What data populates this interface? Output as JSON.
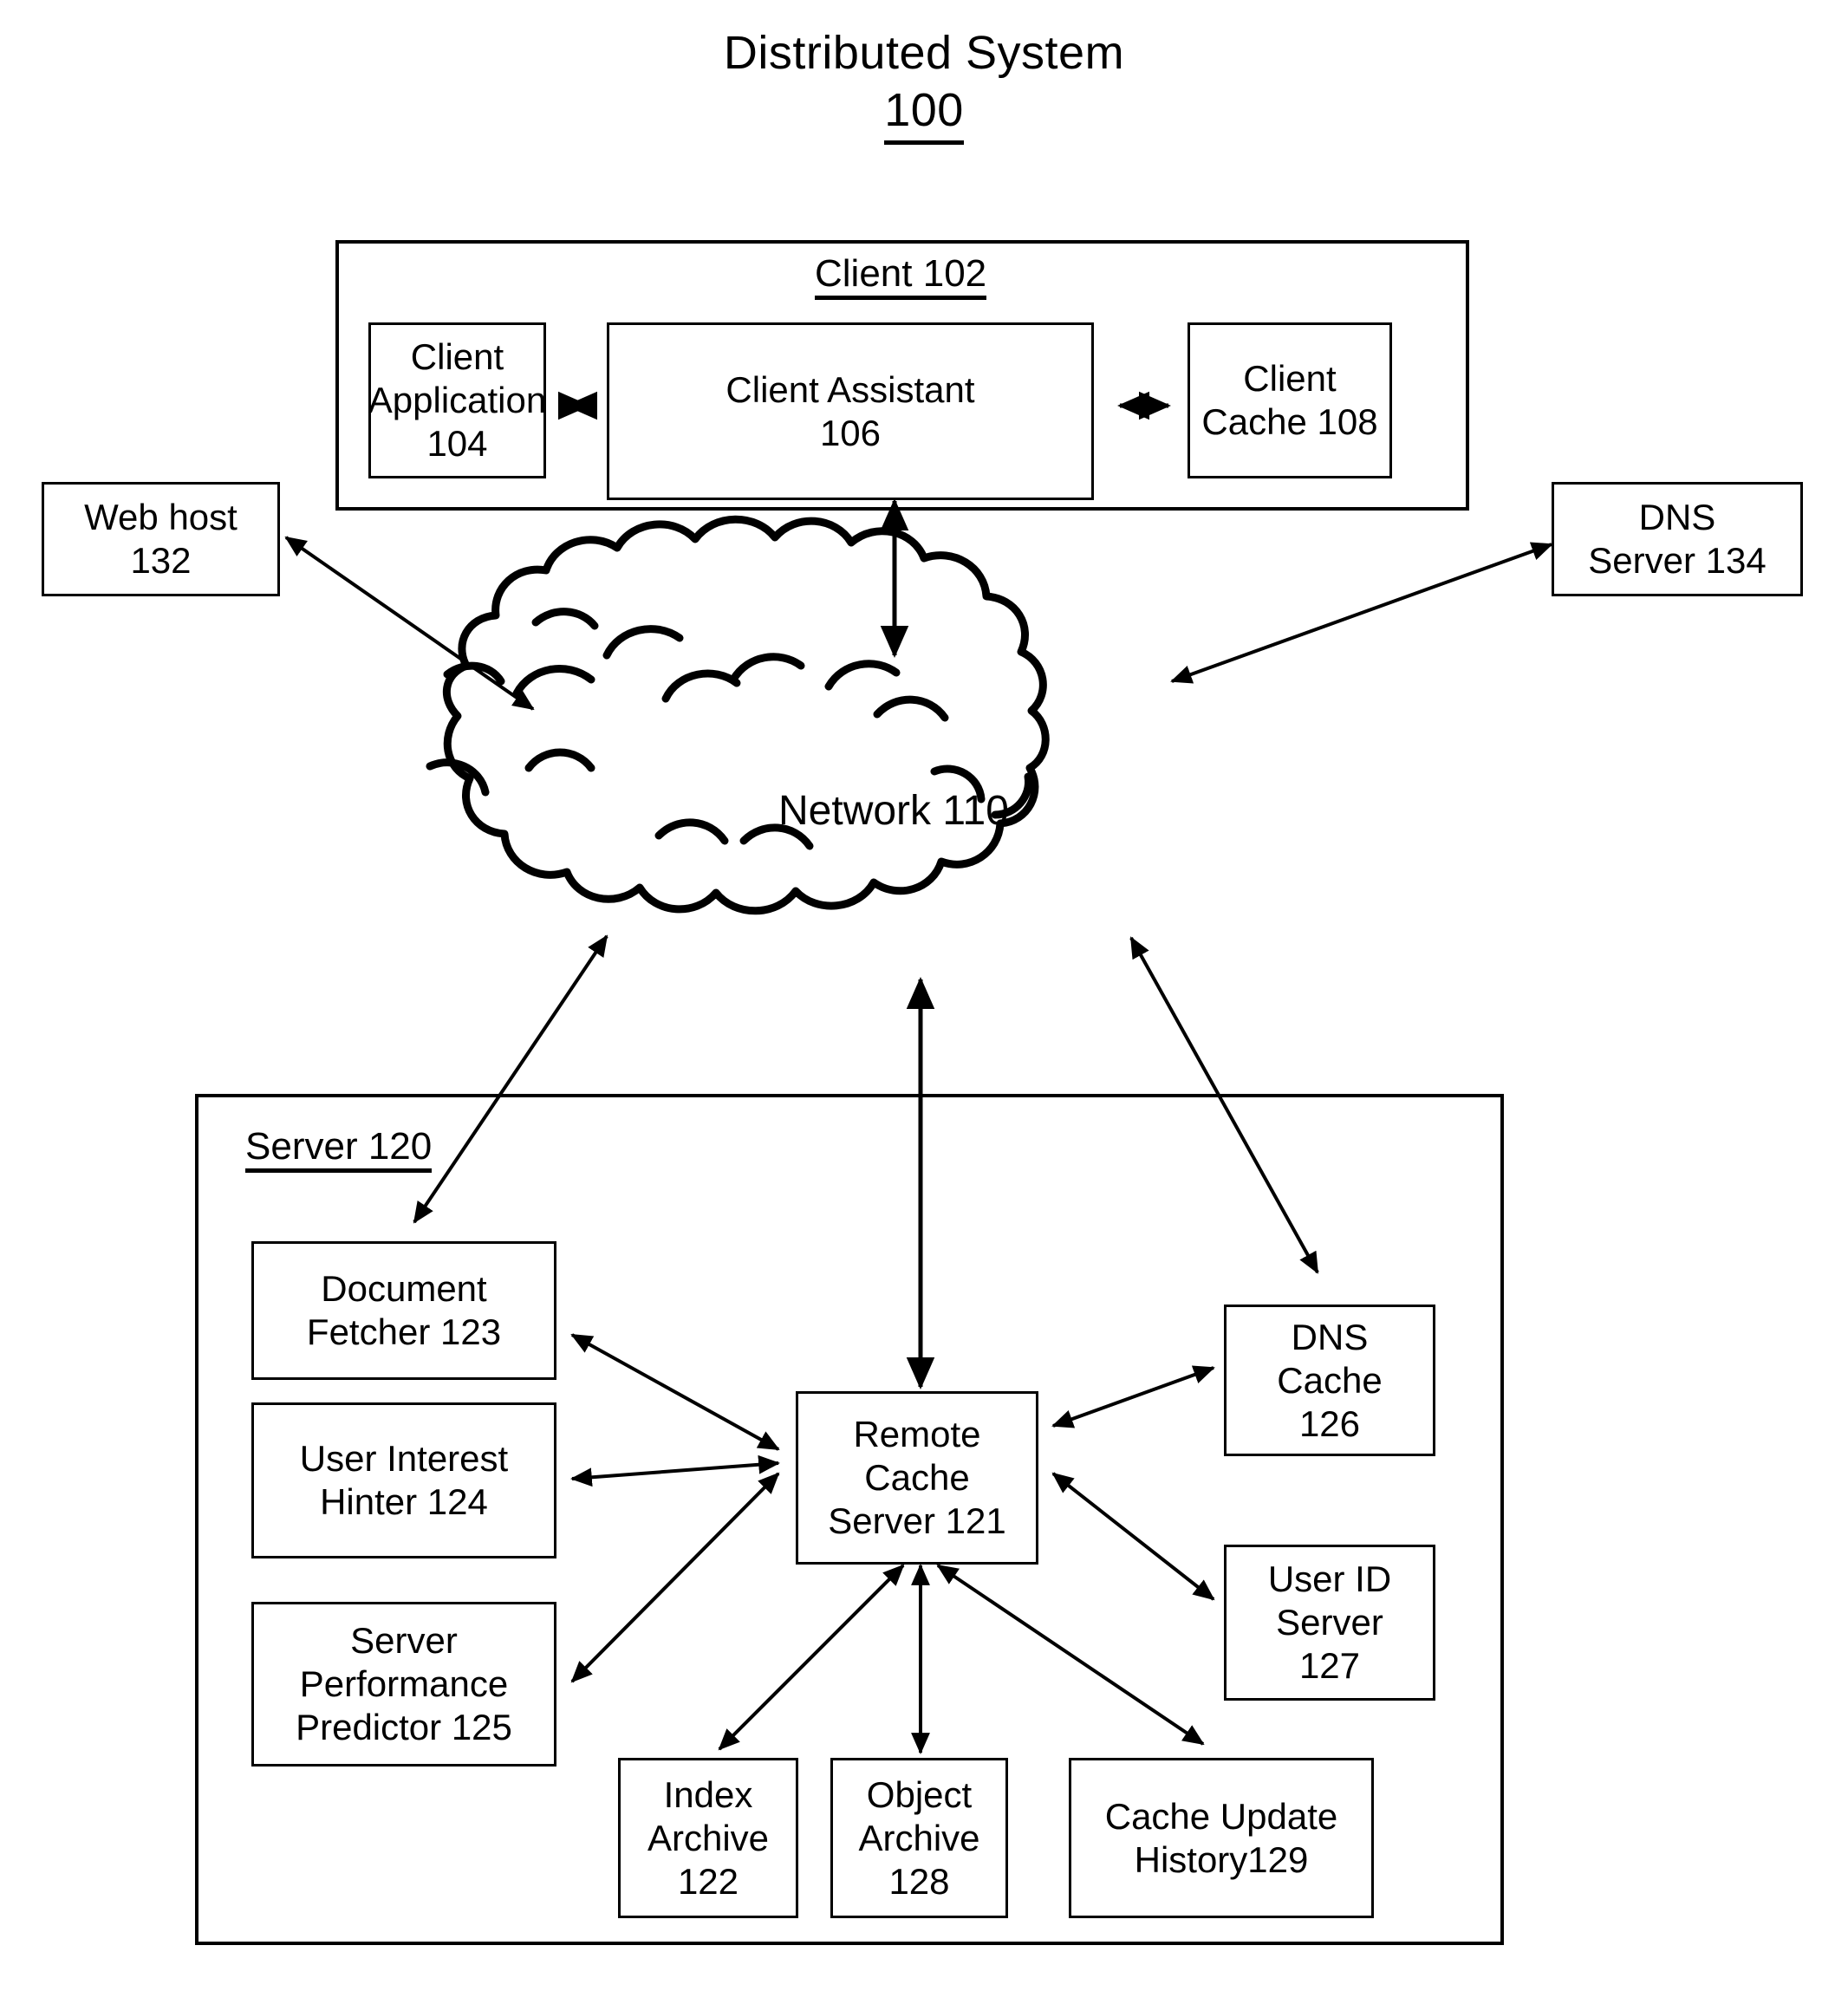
{
  "figure": {
    "title_line1": "Distributed System",
    "title_number": "100"
  },
  "client_group": {
    "label_text": "Client 102",
    "nodes": [
      {
        "id": "client-application",
        "label": "Client\nApplication\n104"
      },
      {
        "id": "client-assistant",
        "label": "Client Assistant\n106"
      },
      {
        "id": "client-cache",
        "label": "Client\nCache 108"
      }
    ]
  },
  "external_nodes": [
    {
      "id": "web-host",
      "label": "Web host\n132"
    },
    {
      "id": "dns-server",
      "label": "DNS\nServer 134"
    }
  ],
  "network": {
    "label": "Network 110"
  },
  "server_group": {
    "label_text": "Server 120",
    "nodes": [
      {
        "id": "document-fetcher",
        "label": "Document\nFetcher 123"
      },
      {
        "id": "user-interest-hinter",
        "label": "User Interest\nHinter 124"
      },
      {
        "id": "server-performance-predictor",
        "label": "Server\nPerformance\nPredictor 125"
      },
      {
        "id": "remote-cache-server",
        "label": "Remote\nCache\nServer 121"
      },
      {
        "id": "dns-cache",
        "label": "DNS\nCache\n126"
      },
      {
        "id": "user-id-server",
        "label": "User ID\nServer\n127"
      },
      {
        "id": "index-archive",
        "label": "Index\nArchive\n122"
      },
      {
        "id": "object-archive",
        "label": "Object\nArchive\n128"
      },
      {
        "id": "cache-update-history",
        "label": "Cache Update\nHistory129"
      }
    ]
  },
  "colors": {
    "stroke": "#000000",
    "background": "#ffffff"
  }
}
